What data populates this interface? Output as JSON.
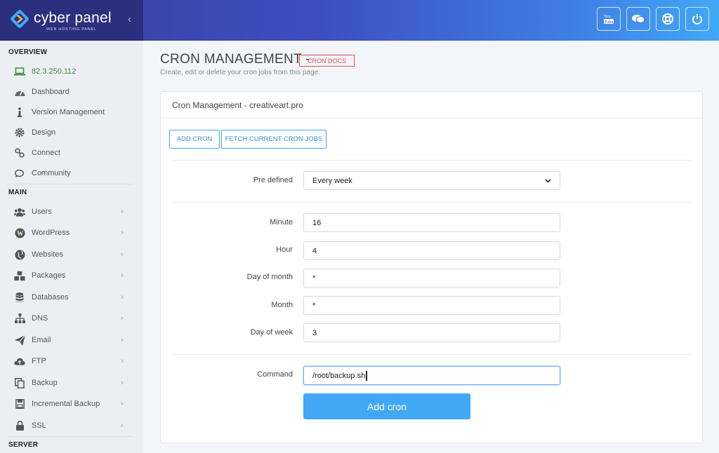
{
  "brand": {
    "name": "cyber panel",
    "tagline": "WEB HOSTING PANEL"
  },
  "topbar": {
    "actions": [
      "youtube-icon",
      "chat-icon",
      "support-icon",
      "power-icon"
    ]
  },
  "sidebar": {
    "overview_heading": "OVERVIEW",
    "main_heading": "MAIN",
    "server_heading": "SERVER",
    "ip": "82.3.250.112",
    "overview_items": [
      {
        "label": "Dashboard",
        "icon": "dashboard-icon"
      },
      {
        "label": "Version Management",
        "icon": "info-icon"
      },
      {
        "label": "Design",
        "icon": "gear-icon"
      },
      {
        "label": "Connect",
        "icon": "link-icon"
      },
      {
        "label": "Community",
        "icon": "comments-icon"
      }
    ],
    "main_items": [
      {
        "label": "Users",
        "icon": "users-icon"
      },
      {
        "label": "WordPress",
        "icon": "wordpress-icon"
      },
      {
        "label": "Websites",
        "icon": "globe-icon"
      },
      {
        "label": "Packages",
        "icon": "cubes-icon"
      },
      {
        "label": "Databases",
        "icon": "database-icon"
      },
      {
        "label": "DNS",
        "icon": "sitemap-icon"
      },
      {
        "label": "Email",
        "icon": "paper-plane-icon"
      },
      {
        "label": "FTP",
        "icon": "cloud-upload-icon"
      },
      {
        "label": "Backup",
        "icon": "copy-icon"
      },
      {
        "label": "Incremental Backup",
        "icon": "save-icon"
      },
      {
        "label": "SSL",
        "icon": "lock-icon"
      }
    ],
    "colors": {
      "ip_text": "#3d8b3d",
      "background": "#eceef3"
    }
  },
  "page": {
    "title": "CRON MANAGEMENT -",
    "docs_badge": "CRON DOCS",
    "description": "Create, edit or delete your cron jobs from this page."
  },
  "panel": {
    "title": "Cron Management - creativeart.pro",
    "add_cron_button": "ADD CRON",
    "fetch_button": "FETCH CURRENT CRON JOBS",
    "form": {
      "predefined_label": "Pre defined",
      "predefined_value": "Every week",
      "minute_label": "Minute",
      "minute_value": "16",
      "hour_label": "Hour",
      "hour_value": "4",
      "day_of_month_label": "Day of month",
      "day_of_month_value": "*",
      "month_label": "Month",
      "month_value": "*",
      "day_of_week_label": "Day of week",
      "day_of_week_value": "3",
      "command_label": "Command",
      "command_value": "/root/backup.sh",
      "submit_label": "Add cron"
    }
  },
  "colors": {
    "accent": "#41a8f5",
    "docs_badge": "#e05555",
    "topbar_start": "#3b3d9c",
    "topbar_end": "#41a8f5"
  }
}
